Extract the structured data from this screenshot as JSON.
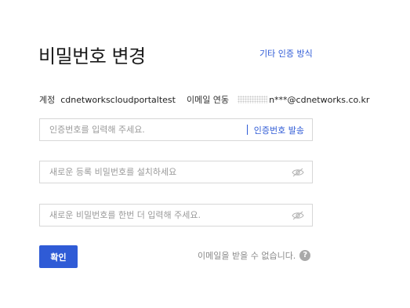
{
  "header": {
    "title": "비밀번호 변경",
    "other_auth_link": "기타 인증 방식"
  },
  "account": {
    "account_label": "계정",
    "account_value": "cdnetworkscloudportaltest",
    "email_label": "이메일 연동",
    "email_masked": "n***@cdnetworks.co.kr"
  },
  "form": {
    "code_placeholder": "인증번호를 입력해 주세요.",
    "send_code_label": "인증번호 발송",
    "new_password_placeholder": "새로운 등록 비밀번호를 설치하세요",
    "confirm_password_placeholder": "새로운 비밀번호를 한번 더 입력해 주세요.",
    "confirm_button": "확인",
    "no_email_text": "이메일을 받을 수 없습니다.",
    "help_icon_glyph": "?"
  },
  "colors": {
    "accent": "#2f5bd6",
    "border": "#d7d7d7",
    "muted_text": "#8a8a8a"
  }
}
